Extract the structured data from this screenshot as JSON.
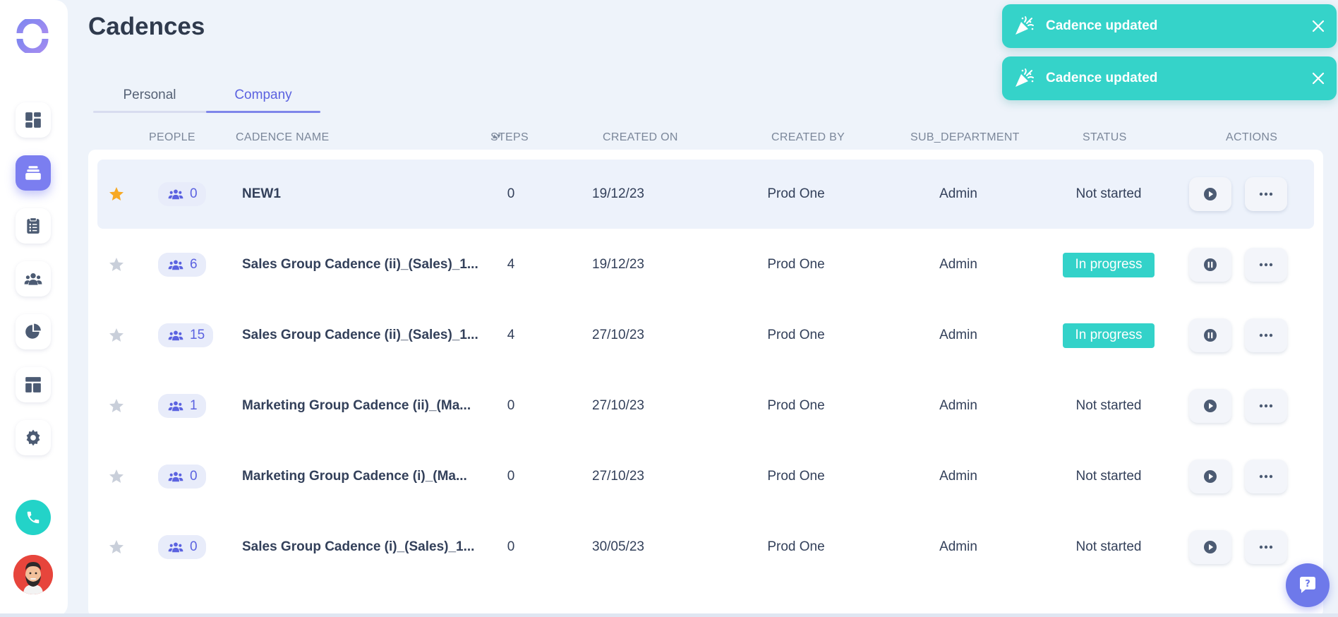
{
  "page": {
    "title": "Cadences"
  },
  "tabs": [
    {
      "label": "Personal",
      "active": false
    },
    {
      "label": "Company",
      "active": true
    }
  ],
  "table": {
    "columns": {
      "people": "PEOPLE",
      "name": "CADENCE NAME",
      "steps": "STEPS",
      "created_on": "CREATED ON",
      "created_by": "CREATED BY",
      "sub_department": "SUB_DEPARTMENT",
      "status": "STATUS",
      "actions": "ACTIONS"
    },
    "rows": [
      {
        "starred": true,
        "people": "0",
        "name": "NEW1",
        "steps": "0",
        "created_on": "19/12/23",
        "created_by": "Prod One",
        "sub_department": "Admin",
        "status": "Not started",
        "action": "play-icon"
      },
      {
        "starred": false,
        "people": "6",
        "name": "Sales Group Cadence (ii)_(Sales)_1...",
        "steps": "4",
        "created_on": "19/12/23",
        "created_by": "Prod One",
        "sub_department": "Admin",
        "status": "In progress",
        "action": "pause-icon"
      },
      {
        "starred": false,
        "people": "15",
        "name": "Sales Group Cadence (ii)_(Sales)_1...",
        "steps": "4",
        "created_on": "27/10/23",
        "created_by": "Prod One",
        "sub_department": "Admin",
        "status": "In progress",
        "action": "pause-icon"
      },
      {
        "starred": false,
        "people": "1",
        "name": "Marketing Group Cadence (ii)_(Ma...",
        "steps": "0",
        "created_on": "27/10/23",
        "created_by": "Prod One",
        "sub_department": "Admin",
        "status": "Not started",
        "action": "play-icon"
      },
      {
        "starred": false,
        "people": "0",
        "name": "Marketing Group Cadence (i)_(Ma...",
        "steps": "0",
        "created_on": "27/10/23",
        "created_by": "Prod One",
        "sub_department": "Admin",
        "status": "Not started",
        "action": "play-icon"
      },
      {
        "starred": false,
        "people": "0",
        "name": "Sales Group Cadence (i)_(Sales)_1...",
        "steps": "0",
        "created_on": "30/05/23",
        "created_by": "Prod One",
        "sub_department": "Admin",
        "status": "Not started",
        "action": "play-icon"
      }
    ]
  },
  "toasts": [
    {
      "message": "Cadence updated"
    },
    {
      "message": "Cadence updated"
    }
  ],
  "sidebar": {
    "items": [
      "dashboard-icon",
      "cadences-icon",
      "tasks-icon",
      "people-icon",
      "reports-icon",
      "templates-icon",
      "settings-icon"
    ],
    "active": "cadences-icon"
  },
  "colors": {
    "accent": "#7b7ef0",
    "teal": "#35d3c9",
    "star_active": "#f7a924",
    "star_inactive": "#c9cfda"
  }
}
